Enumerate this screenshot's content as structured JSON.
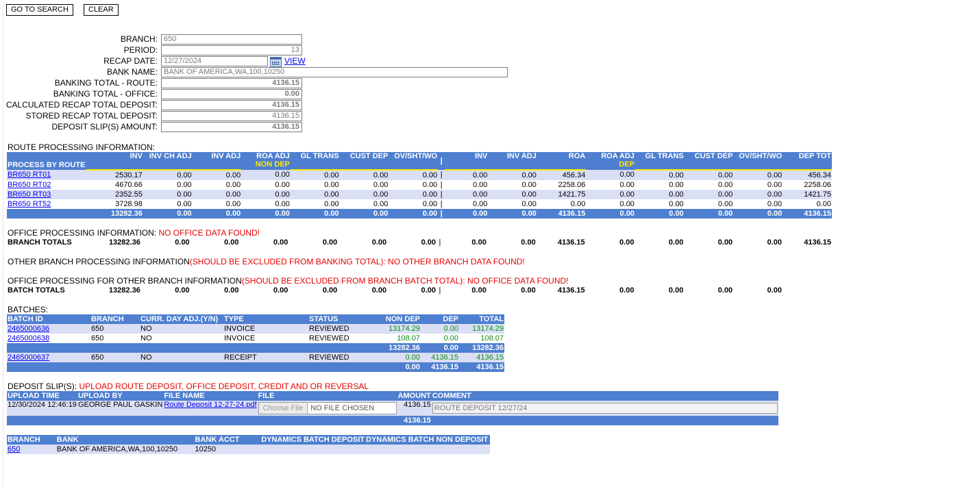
{
  "toolbar": {
    "go_search": "GO TO SEARCH",
    "clear": "CLEAR"
  },
  "form": {
    "branch_label": "BRANCH:",
    "branch": "650",
    "period_label": "PERIOD:",
    "period": "13",
    "recap_date_label": "RECAP DATE:",
    "recap_date": "12/27/2024",
    "view": "VIEW",
    "bank_name_label": "BANK NAME:",
    "bank_name": "BANK OF AMERICA,WA,100,10250",
    "bt_route_label": "BANKING TOTAL - ROUTE:",
    "bt_route": "4136.15",
    "bt_office_label": "BANKING TOTAL - OFFICE:",
    "bt_office": "0.00",
    "calc_label": "CALCULATED RECAP TOTAL DEPOSIT:",
    "calc": "4136.15",
    "stored_label": "STORED RECAP TOTAL DEPOSIT:",
    "stored": "4136.15",
    "slip_label": "DEPOSIT SLIP(S) AMOUNT:",
    "slip": "4136.15"
  },
  "route": {
    "title": "ROUTE PROCESSING INFORMATION:",
    "headers": [
      "PROCESS BY ROUTE",
      "INV",
      "INV CH ADJ",
      "INV ADJ",
      "ROA ADJ",
      "GL TRANS",
      "CUST DEP",
      "OV/SHT/WO",
      "|",
      "INV",
      "INV ADJ",
      "ROA",
      "ROA ADJ",
      "GL TRANS",
      "CUST DEP",
      "OV/SHT/WO",
      "DEP TOT"
    ],
    "sub_nondep": "NON DEP",
    "sub_dep": "DEP",
    "rows": [
      {
        "id": "BR650 RT01",
        "v": [
          "2530.17",
          "0.00",
          "0.00",
          "0.00",
          "0.00",
          "0.00",
          "0.00",
          "|",
          "0.00",
          "0.00",
          "456.34",
          "0.00",
          "0.00",
          "0.00",
          "0.00",
          "456.34"
        ]
      },
      {
        "id": "BR650 RT02",
        "v": [
          "4670.66",
          "0.00",
          "0.00",
          "0.00",
          "0.00",
          "0.00",
          "0.00",
          "|",
          "0.00",
          "0.00",
          "2258.06",
          "0.00",
          "0.00",
          "0.00",
          "0.00",
          "2258.06"
        ]
      },
      {
        "id": "BR650 RT03",
        "v": [
          "2352.55",
          "0.00",
          "0.00",
          "0.00",
          "0.00",
          "0.00",
          "0.00",
          "|",
          "0.00",
          "0.00",
          "1421.75",
          "0.00",
          "0.00",
          "0.00",
          "0.00",
          "1421.75"
        ]
      },
      {
        "id": "BR650 RT52",
        "v": [
          "3728.98",
          "0.00",
          "0.00",
          "0.00",
          "0.00",
          "0.00",
          "0.00",
          "|",
          "0.00",
          "0.00",
          "0.00",
          "0.00",
          "0.00",
          "0.00",
          "0.00",
          "0.00"
        ]
      }
    ],
    "total": [
      "",
      "13282.36",
      "0.00",
      "0.00",
      "0.00",
      "0.00",
      "0.00",
      "0.00",
      "|",
      "0.00",
      "0.00",
      "4136.15",
      "0.00",
      "0.00",
      "0.00",
      "0.00",
      "4136.15"
    ]
  },
  "office": {
    "title": "OFFICE PROCESSING INFORMATION: ",
    "msg": "NO OFFICE DATA FOUND!",
    "branch_totals": [
      "BRANCH TOTALS",
      "13282.36",
      "0.00",
      "0.00",
      "0.00",
      "0.00",
      "0.00",
      "0.00",
      "|",
      "0.00",
      "0.00",
      "4136.15",
      "0.00",
      "0.00",
      "0.00",
      "0.00",
      "4136.15"
    ]
  },
  "other_branch": {
    "title": "OTHER BRANCH PROCESSING INFORMATION",
    "note": "(SHOULD BE EXCLUDED FROM BANKING TOTAL):  NO OTHER BRANCH DATA FOUND!"
  },
  "office_other": {
    "title": "OFFICE PROCESSING FOR OTHER BRANCH INFORMATION",
    "note": "(SHOULD BE EXCLUDED FROM BRANCH BATCH TOTAL): NO OFFICE DATA FOUND!",
    "batch_totals": [
      "BATCH TOTALS",
      "13282.36",
      "0.00",
      "0.00",
      "0.00",
      "0.00",
      "0.00",
      "0.00",
      "|",
      "0.00",
      "0.00",
      "4136.15",
      "0.00",
      "0.00",
      "0.00",
      "0.00",
      ""
    ]
  },
  "batches": {
    "title": "BATCHES:",
    "headers": [
      "BATCH ID",
      "BRANCH",
      "CURR. DAY ADJ.(Y/N)",
      "TYPE",
      "STATUS",
      "NON DEP",
      "DEP",
      "TOTAL"
    ],
    "rows": [
      {
        "id": "2465000636",
        "branch": "650",
        "adj": "NO",
        "type": "INVOICE",
        "status": "REVIEWED",
        "nondep": "13174.29",
        "dep": "0.00",
        "total": "13174.29"
      },
      {
        "id": "2465000638",
        "branch": "650",
        "adj": "NO",
        "type": "INVOICE",
        "status": "REVIEWED",
        "nondep": "108.07",
        "dep": "0.00",
        "total": "108.07"
      }
    ],
    "sub1": {
      "nondep": "13282.36",
      "dep": "0.00",
      "total": "13282.36"
    },
    "rows2": [
      {
        "id": "2465000637",
        "branch": "650",
        "adj": "NO",
        "type": "RECEIPT",
        "status": "REVIEWED",
        "nondep": "0.00",
        "dep": "4136.15",
        "total": "4136.15"
      }
    ],
    "sub2": {
      "nondep": "0.00",
      "dep": "4136.15",
      "total": "4136.15"
    }
  },
  "deposit": {
    "title": "DEPOSIT SLIP(S): ",
    "link": "UPLOAD ROUTE DEPOSIT, OFFICE DEPOSIT, CREDIT AND OR REVERSAL",
    "headers": [
      "UPLOAD TIME",
      "UPLOAD BY",
      "FILE NAME",
      "FILE",
      "AMOUNT",
      "COMMENT"
    ],
    "row": {
      "time": "12/30/2024 12:46:19",
      "by": "GEORGE PAUL GASKIN",
      "file": "Route Deposit 12-27-24.pdf",
      "choose": "Choose File",
      "nofile": "NO FILE CHOSEN",
      "amount": "4136.15",
      "comment": "ROUTE DEPOSIT 12/27/24"
    },
    "total": "4136.15"
  },
  "bank": {
    "headers": [
      "BRANCH",
      "BANK",
      "BANK ACCT",
      "DYNAMICS BATCH DEPOSIT",
      "DYNAMICS BATCH NON DEPOSIT"
    ],
    "row": {
      "branch": "650",
      "bank": "BANK OF AMERICA,WA,100,10250",
      "acct": "10250",
      "dbd": "",
      "dbnd": ""
    }
  }
}
